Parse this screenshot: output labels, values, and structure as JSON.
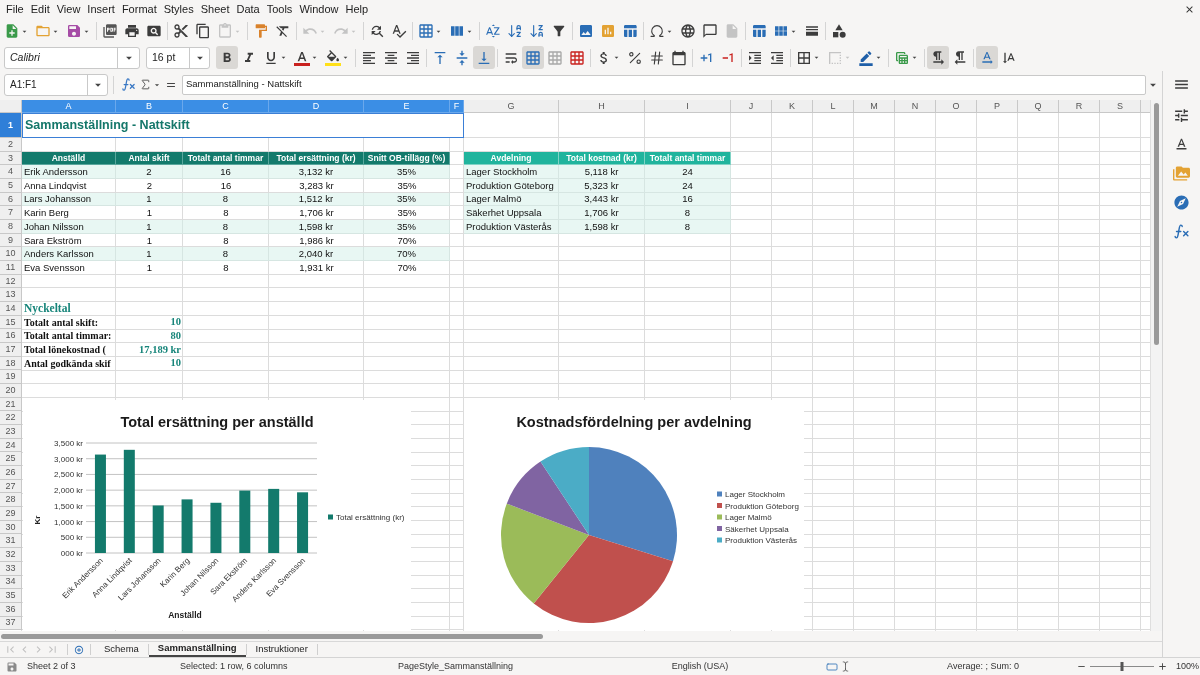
{
  "menu": [
    "File",
    "Edit",
    "View",
    "Insert",
    "Format",
    "Styles",
    "Sheet",
    "Data",
    "Tools",
    "Window",
    "Help"
  ],
  "standard_toolbar": [
    [
      {
        "kind": "new",
        "disabled": false
      },
      {
        "kind": "open",
        "disabled": false
      },
      {
        "kind": "save",
        "disabled": false
      }
    ],
    [
      {
        "kind": "export_pdf",
        "disabled": false
      },
      {
        "kind": "print",
        "disabled": false
      },
      {
        "kind": "print_preview",
        "disabled": false
      }
    ],
    [
      {
        "kind": "cut",
        "disabled": false
      },
      {
        "kind": "copy",
        "disabled": false
      },
      {
        "kind": "paste",
        "disabled": true
      }
    ],
    [
      {
        "kind": "clone_formatting",
        "disabled": false
      },
      {
        "kind": "clear_formatting",
        "disabled": false
      }
    ],
    [
      {
        "kind": "undo",
        "disabled": true
      },
      {
        "kind": "redo",
        "disabled": true
      }
    ],
    [
      {
        "kind": "find_replace",
        "disabled": false
      },
      {
        "kind": "spelling",
        "disabled": false
      }
    ],
    [
      {
        "kind": "rows",
        "disabled": false
      },
      {
        "kind": "columns",
        "disabled": false
      }
    ],
    [
      {
        "kind": "sort",
        "disabled": false
      },
      {
        "kind": "sort_ascending",
        "disabled": false
      },
      {
        "kind": "sort_descending",
        "disabled": false
      },
      {
        "kind": "autofilter",
        "disabled": false
      }
    ],
    [
      {
        "kind": "image",
        "disabled": false
      },
      {
        "kind": "chart",
        "disabled": false
      },
      {
        "kind": "pivot_table",
        "disabled": false
      }
    ],
    [
      {
        "kind": "special_character",
        "disabled": false
      },
      {
        "kind": "hyperlink",
        "disabled": false
      },
      {
        "kind": "comment",
        "disabled": false
      },
      {
        "kind": "header_footer",
        "disabled": true
      }
    ],
    [
      {
        "kind": "print_area",
        "disabled": false
      },
      {
        "kind": "freeze",
        "disabled": false
      },
      {
        "kind": "split_window",
        "disabled": false
      }
    ],
    [
      {
        "kind": "draw_functions",
        "disabled": false
      }
    ]
  ],
  "formatting_toolbar": {
    "font_name": "Calibri",
    "font_size": "16 pt",
    "groups": [
      [
        {
          "kind": "bold",
          "on": true,
          "disabled": false
        },
        {
          "kind": "italic",
          "on": false,
          "disabled": false
        },
        {
          "kind": "underline",
          "on": false,
          "disabled": false
        },
        {
          "kind": "font_color",
          "on": false,
          "disabled": false
        },
        {
          "kind": "highlight",
          "on": false,
          "disabled": false
        }
      ],
      [
        {
          "kind": "align_left",
          "on": false,
          "disabled": false
        },
        {
          "kind": "align_center",
          "on": false,
          "disabled": false
        },
        {
          "kind": "align_right",
          "on": false,
          "disabled": false
        }
      ],
      [
        {
          "kind": "align_top",
          "on": false,
          "disabled": false
        },
        {
          "kind": "align_middle",
          "on": false,
          "disabled": false
        },
        {
          "kind": "align_bottom",
          "on": true,
          "disabled": false
        }
      ],
      [
        {
          "kind": "wrap_text",
          "on": false,
          "disabled": false
        },
        {
          "kind": "merge_center",
          "on": true,
          "disabled": false
        },
        {
          "kind": "merge_cells",
          "on": false,
          "disabled": false
        },
        {
          "kind": "unmerge_cells",
          "on": false,
          "disabled": false
        }
      ],
      [
        {
          "kind": "currency",
          "on": false,
          "disabled": false
        },
        {
          "kind": "percent",
          "on": false,
          "disabled": false
        },
        {
          "kind": "number",
          "on": false,
          "disabled": false
        },
        {
          "kind": "date",
          "on": false,
          "disabled": false
        }
      ],
      [
        {
          "kind": "add_decimal",
          "on": false,
          "disabled": false
        },
        {
          "kind": "delete_decimal",
          "on": false,
          "disabled": false
        }
      ],
      [
        {
          "kind": "increase_indent",
          "on": false,
          "disabled": false
        },
        {
          "kind": "decrease_indent",
          "on": false,
          "disabled": false
        }
      ],
      [
        {
          "kind": "borders",
          "on": false,
          "disabled": false
        },
        {
          "kind": "border_style",
          "on": false,
          "disabled": true
        },
        {
          "kind": "border_color",
          "on": false,
          "disabled": false
        }
      ],
      [
        {
          "kind": "conditional",
          "on": false,
          "disabled": false
        }
      ],
      [
        {
          "kind": "left_to_right",
          "on": true,
          "disabled": false
        },
        {
          "kind": "right_to_left",
          "on": false,
          "disabled": false
        }
      ],
      [
        {
          "kind": "horizontal_text",
          "on": true,
          "disabled": false
        },
        {
          "kind": "vertical_text",
          "on": false,
          "disabled": false
        }
      ]
    ]
  },
  "formula_bar": {
    "name_box": "A1:F1",
    "formula": "Sammanställning - Nattskift"
  },
  "sheet": {
    "columns": [
      {
        "label": "A",
        "selected": true
      },
      {
        "label": "B",
        "selected": true
      },
      {
        "label": "C",
        "selected": true
      },
      {
        "label": "D",
        "selected": true
      },
      {
        "label": "E",
        "selected": true
      },
      {
        "label": "F",
        "selected": true
      },
      {
        "label": "G",
        "selected": false
      },
      {
        "label": "H",
        "selected": false
      },
      {
        "label": "I",
        "selected": false
      },
      {
        "label": "J",
        "selected": false
      },
      {
        "label": "K",
        "selected": false
      },
      {
        "label": "L",
        "selected": false
      },
      {
        "label": "M",
        "selected": false
      },
      {
        "label": "N",
        "selected": false
      },
      {
        "label": "O",
        "selected": false
      },
      {
        "label": "P",
        "selected": false
      },
      {
        "label": "Q",
        "selected": false
      },
      {
        "label": "R",
        "selected": false
      },
      {
        "label": "S",
        "selected": false
      }
    ],
    "rows": [
      {
        "label": "1",
        "selected": true
      },
      {
        "label": "2",
        "selected": false
      },
      {
        "label": "3",
        "selected": false
      },
      {
        "label": "4",
        "selected": false
      },
      {
        "label": "5",
        "selected": false
      },
      {
        "label": "6",
        "selected": false
      },
      {
        "label": "7",
        "selected": false
      },
      {
        "label": "8",
        "selected": false
      },
      {
        "label": "9",
        "selected": false
      },
      {
        "label": "10",
        "selected": false
      },
      {
        "label": "11",
        "selected": false
      },
      {
        "label": "12",
        "selected": false
      },
      {
        "label": "13",
        "selected": false
      },
      {
        "label": "14",
        "selected": false
      },
      {
        "label": "15",
        "selected": false
      },
      {
        "label": "16",
        "selected": false
      },
      {
        "label": "17",
        "selected": false
      },
      {
        "label": "18",
        "selected": false
      },
      {
        "label": "19",
        "selected": false
      },
      {
        "label": "20",
        "selected": false
      },
      {
        "label": "21",
        "selected": false
      },
      {
        "label": "22",
        "selected": false
      },
      {
        "label": "23",
        "selected": false
      },
      {
        "label": "24",
        "selected": false
      },
      {
        "label": "25",
        "selected": false
      },
      {
        "label": "26",
        "selected": false
      },
      {
        "label": "27",
        "selected": false
      },
      {
        "label": "28",
        "selected": false
      },
      {
        "label": "29",
        "selected": false
      },
      {
        "label": "30",
        "selected": false
      },
      {
        "label": "31",
        "selected": false
      },
      {
        "label": "32",
        "selected": false
      },
      {
        "label": "33",
        "selected": false
      },
      {
        "label": "34",
        "selected": false
      },
      {
        "label": "35",
        "selected": false
      },
      {
        "label": "36",
        "selected": false
      },
      {
        "label": "37",
        "selected": false
      }
    ],
    "title": "Sammanställning - Nattskift",
    "employees": {
      "columns": [
        "Anställd",
        "Antal skift",
        "Totalt antal timmar",
        "Total ersättning (kr)",
        "Snitt OB-tillägg (%)"
      ],
      "rows": [
        [
          "Erik Andersson",
          "2",
          "16",
          "3,132 kr",
          "35%"
        ],
        [
          "Anna Lindqvist",
          "2",
          "16",
          "3,283 kr",
          "35%"
        ],
        [
          "Lars Johansson",
          "1",
          "8",
          "1,512 kr",
          "35%"
        ],
        [
          "Karin Berg",
          "1",
          "8",
          "1,706 kr",
          "35%"
        ],
        [
          "Johan Nilsson",
          "1",
          "8",
          "1,598 kr",
          "35%"
        ],
        [
          "Sara Ekström",
          "1",
          "8",
          "1,986 kr",
          "70%"
        ],
        [
          "Anders Karlsson",
          "1",
          "8",
          "2,040 kr",
          "70%"
        ],
        [
          "Eva Svensson",
          "1",
          "8",
          "1,931 kr",
          "70%"
        ]
      ]
    },
    "departments": {
      "columns": [
        "Avdelning",
        "Total kostnad (kr)",
        "Totalt antal timmar"
      ],
      "rows": [
        [
          "Lager Stockholm",
          "5,118 kr",
          "24"
        ],
        [
          "Produktion Göteborg",
          "5,323 kr",
          "24"
        ],
        [
          "Lager Malmö",
          "3,443 kr",
          "16"
        ],
        [
          "Säkerhet Uppsala",
          "1,706 kr",
          "8"
        ],
        [
          "Produktion Västerås",
          "1,598 kr",
          "8"
        ]
      ]
    },
    "key_figures": {
      "title": "Nyckeltal",
      "items": [
        {
          "label": "Totalt antal skift:",
          "value": "10"
        },
        {
          "label": "Totalt antal timmar:",
          "value": "80"
        },
        {
          "label": "Total lönekostnad (",
          "value": "17,189 kr"
        },
        {
          "label": "Antal godkända skif",
          "value": "10"
        }
      ]
    },
    "charts": [
      {
        "chart_data": {
          "type": "bar",
          "title": "Total ersättning per anställd",
          "xlabel": "Anställd",
          "ylabel": "Kr",
          "categories": [
            "Erik Andersson",
            "Anna Lindqvist",
            "Lars Johansson",
            "Karin Berg",
            "Johan Nilsson",
            "Sara Ekström",
            "Anders Karlsson",
            "Eva Svensson"
          ],
          "series": [
            {
              "name": "Total ersättning (kr)",
              "color": "#137a6c",
              "values": [
                3132,
                3283,
                1512,
                1706,
                1598,
                1986,
                2040,
                1931
              ]
            }
          ],
          "ylim": [
            0,
            3500
          ],
          "yticks": [
            {
              "value": 0,
              "label": "000 kr"
            },
            {
              "value": 500,
              "label": "500 kr"
            },
            {
              "value": 1000,
              "label": "1,000 kr"
            },
            {
              "value": 1500,
              "label": "1,500 kr"
            },
            {
              "value": 2000,
              "label": "2,000 kr"
            },
            {
              "value": 2500,
              "label": "2,500 kr"
            },
            {
              "value": 3000,
              "label": "3,000 kr"
            },
            {
              "value": 3500,
              "label": "3,500 kr"
            }
          ],
          "grid": true,
          "legend": "right"
        }
      },
      {
        "chart_data": {
          "type": "pie",
          "title": "Kostnadsfördelning per avdelning",
          "categories": [
            "Lager Stockholm",
            "Produktion Göteborg",
            "Lager Malmö",
            "Säkerhet Uppsala",
            "Produktion Västerås"
          ],
          "values": [
            29.8,
            31.0,
            20.0,
            9.9,
            9.3
          ],
          "colors": [
            "#4f81bd",
            "#c0504d",
            "#9bbb59",
            "#8064a2",
            "#4bacc6"
          ],
          "legend": "right"
        }
      }
    ]
  },
  "sheet_tabs": [
    {
      "label": "Schema",
      "selected": false
    },
    {
      "label": "Sammanställning",
      "selected": true
    },
    {
      "label": "Instruktioner",
      "selected": false
    }
  ],
  "status_bar": {
    "sheet": "Sheet 2 of 3",
    "selection": "Selected: 1 row, 6 columns",
    "page_style": "PageStyle_Sammanställning",
    "language": "English (USA)",
    "summary": "Average: ; Sum: 0",
    "zoom_slider": {
      "level": 0.5
    },
    "zoom": "100%"
  }
}
